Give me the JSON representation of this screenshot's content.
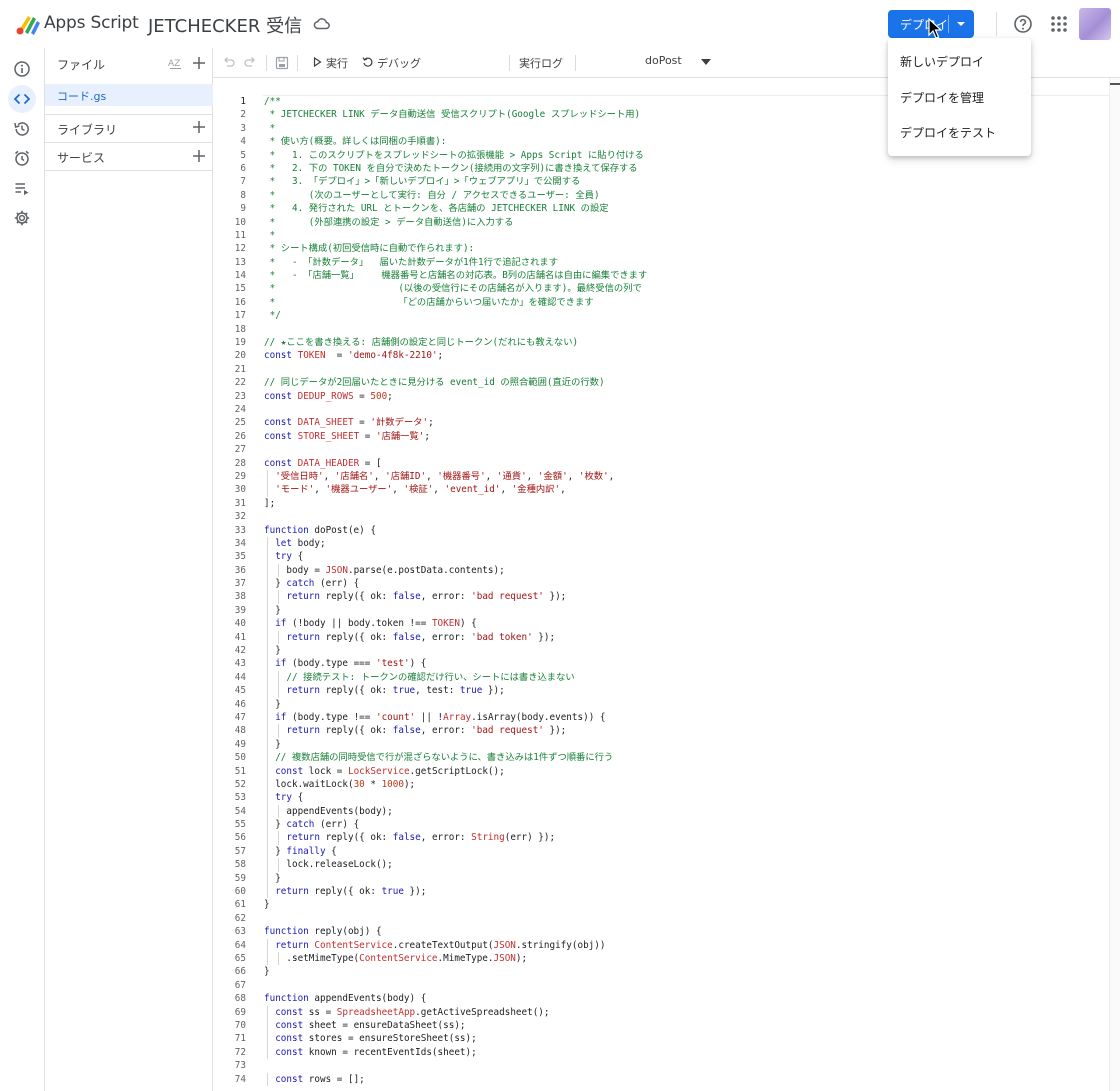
{
  "app": {
    "name": "Apps Script",
    "project_title": "JETCHECKER 受信"
  },
  "header": {
    "deploy_label": "デプロイ"
  },
  "deploy_menu": {
    "items": [
      "新しいデプロイ",
      "デプロイを管理",
      "デプロイをテスト"
    ]
  },
  "files_panel": {
    "title": "ファイル",
    "file": "コード.gs",
    "libraries": "ライブラリ",
    "services": "サービス"
  },
  "toolbar": {
    "run": "実行",
    "debug": "デバッグ",
    "function": "doPost",
    "log": "実行ログ"
  },
  "editor": {
    "active_line": 1,
    "lines": [
      [
        [
          "cm",
          "/**"
        ]
      ],
      [
        [
          "cm",
          " * JETCHECKER LINK データ自動送信 受信スクリプト(Google スプレッドシート用)"
        ]
      ],
      [
        [
          "cm",
          " *"
        ]
      ],
      [
        [
          "cm",
          " * 使い方(概要。詳しくは同梱の手順書):"
        ]
      ],
      [
        [
          "cm",
          " *   1. このスクリプトをスプレッドシートの拡張機能 > Apps Script に貼り付ける"
        ]
      ],
      [
        [
          "cm",
          " *   2. 下の TOKEN を自分で決めたトークン(接続用の文字列)に書き換えて保存する"
        ]
      ],
      [
        [
          "cm",
          " *   3. 「デプロイ」>「新しいデプロイ」>「ウェブアプリ」で公開する"
        ]
      ],
      [
        [
          "cm",
          " *      (次のユーザーとして実行: 自分 / アクセスできるユーザー: 全員)"
        ]
      ],
      [
        [
          "cm",
          " *   4. 発行された URL とトークンを、各店舗の JETCHECKER LINK の設定"
        ]
      ],
      [
        [
          "cm",
          " *      (外部連携の設定 > データ自動送信)に入力する"
        ]
      ],
      [
        [
          "cm",
          " *"
        ]
      ],
      [
        [
          "cm",
          " * シート構成(初回受信時に自動で作られます):"
        ]
      ],
      [
        [
          "cm",
          " *   - 「計数データ」  届いた計数データが1件1行で追記されます"
        ]
      ],
      [
        [
          "cm",
          " *   - 「店舗一覧」    機器番号と店舗名の対応表。B列の店舗名は自由に編集できます"
        ]
      ],
      [
        [
          "cm",
          " *                      (以後の受信行にその店舗名が入ります)。最終受信の列で"
        ]
      ],
      [
        [
          "cm",
          " *                      「どの店舗からいつ届いたか」を確認できます"
        ]
      ],
      [
        [
          "cm",
          " */"
        ]
      ],
      [],
      [
        [
          "cm",
          "// ★ここを書き換える: 店舗側の設定と同じトークン(だれにも教えない)"
        ]
      ],
      [
        [
          "kw",
          "const "
        ],
        [
          "va",
          "TOKEN"
        ],
        [
          "",
          "  = "
        ],
        [
          "st",
          "'demo-4f8k-2210'"
        ],
        [
          "",
          ";"
        ]
      ],
      [],
      [
        [
          "cm",
          "// 同じデータが2回届いたときに見分ける event_id の照合範囲(直近の行数)"
        ]
      ],
      [
        [
          "kw",
          "const "
        ],
        [
          "va",
          "DEDUP_ROWS"
        ],
        [
          "",
          " = "
        ],
        [
          "nu",
          "500"
        ],
        [
          "",
          ";"
        ]
      ],
      [],
      [
        [
          "kw",
          "const "
        ],
        [
          "va",
          "DATA_SHEET"
        ],
        [
          "",
          " = "
        ],
        [
          "st",
          "'計数データ'"
        ],
        [
          "",
          ";"
        ]
      ],
      [
        [
          "kw",
          "const "
        ],
        [
          "va",
          "STORE_SHEET"
        ],
        [
          "",
          " = "
        ],
        [
          "st",
          "'店舗一覧'"
        ],
        [
          "",
          ";"
        ]
      ],
      [],
      [
        [
          "kw",
          "const "
        ],
        [
          "va",
          "DATA_HEADER"
        ],
        [
          "",
          " = ["
        ]
      ],
      [
        [
          "",
          "  "
        ],
        [
          "st",
          "'受信日時'"
        ],
        [
          "",
          ", "
        ],
        [
          "st",
          "'店舗名'"
        ],
        [
          "",
          ", "
        ],
        [
          "st",
          "'店舗ID'"
        ],
        [
          "",
          ", "
        ],
        [
          "st",
          "'機器番号'"
        ],
        [
          "",
          ", "
        ],
        [
          "st",
          "'通貨'"
        ],
        [
          "",
          ", "
        ],
        [
          "st",
          "'金額'"
        ],
        [
          "",
          ", "
        ],
        [
          "st",
          "'枚数'"
        ],
        [
          "",
          ","
        ]
      ],
      [
        [
          "",
          "  "
        ],
        [
          "st",
          "'モード'"
        ],
        [
          "",
          ", "
        ],
        [
          "st",
          "'機器ユーザー'"
        ],
        [
          "",
          ", "
        ],
        [
          "st",
          "'検証'"
        ],
        [
          "",
          ", "
        ],
        [
          "st",
          "'event_id'"
        ],
        [
          "",
          ", "
        ],
        [
          "st",
          "'金種内訳'"
        ],
        [
          "",
          ","
        ]
      ],
      [
        [
          "",
          "];"
        ]
      ],
      [],
      [
        [
          "kw",
          "function "
        ],
        [
          "",
          "doPost(e) {"
        ]
      ],
      [
        [
          "",
          "  "
        ],
        [
          "kw",
          "let "
        ],
        [
          "",
          "body;"
        ]
      ],
      [
        [
          "",
          "  "
        ],
        [
          "kw",
          "try "
        ],
        [
          "",
          "{"
        ]
      ],
      [
        [
          "",
          "    body = "
        ],
        [
          "bi",
          "JSON"
        ],
        [
          "",
          ".parse(e.postData.contents);"
        ]
      ],
      [
        [
          "",
          "  } "
        ],
        [
          "kw",
          "catch "
        ],
        [
          "",
          "(err) {"
        ]
      ],
      [
        [
          "",
          "    "
        ],
        [
          "kw",
          "return "
        ],
        [
          "",
          "reply({ ok: "
        ],
        [
          "kw",
          "false"
        ],
        [
          "",
          ", error: "
        ],
        [
          "st",
          "'bad request'"
        ],
        [
          "",
          " });"
        ]
      ],
      [
        [
          "",
          "  }"
        ]
      ],
      [
        [
          "",
          "  "
        ],
        [
          "kw",
          "if "
        ],
        [
          "",
          "(!body || body.token !== "
        ],
        [
          "va",
          "TOKEN"
        ],
        [
          "",
          ") {"
        ]
      ],
      [
        [
          "",
          "    "
        ],
        [
          "kw",
          "return "
        ],
        [
          "",
          "reply({ ok: "
        ],
        [
          "kw",
          "false"
        ],
        [
          "",
          ", error: "
        ],
        [
          "st",
          "'bad token'"
        ],
        [
          "",
          " });"
        ]
      ],
      [
        [
          "",
          "  }"
        ]
      ],
      [
        [
          "",
          "  "
        ],
        [
          "kw",
          "if "
        ],
        [
          "",
          "(body.type === "
        ],
        [
          "st",
          "'test'"
        ],
        [
          "",
          ") {"
        ]
      ],
      [
        [
          "",
          "    "
        ],
        [
          "cm",
          "// 接続テスト: トークンの確認だけ行い、シートには書き込まない"
        ]
      ],
      [
        [
          "",
          "    "
        ],
        [
          "kw",
          "return "
        ],
        [
          "",
          "reply({ ok: "
        ],
        [
          "kw",
          "true"
        ],
        [
          "",
          ", test: "
        ],
        [
          "kw",
          "true"
        ],
        [
          "",
          " });"
        ]
      ],
      [
        [
          "",
          "  }"
        ]
      ],
      [
        [
          "",
          "  "
        ],
        [
          "kw",
          "if "
        ],
        [
          "",
          "(body.type !== "
        ],
        [
          "st",
          "'count'"
        ],
        [
          "",
          " || !"
        ],
        [
          "bi",
          "Array"
        ],
        [
          "",
          ".isArray(body.events)) {"
        ]
      ],
      [
        [
          "",
          "    "
        ],
        [
          "kw",
          "return "
        ],
        [
          "",
          "reply({ ok: "
        ],
        [
          "kw",
          "false"
        ],
        [
          "",
          ", error: "
        ],
        [
          "st",
          "'bad request'"
        ],
        [
          "",
          " });"
        ]
      ],
      [
        [
          "",
          "  }"
        ]
      ],
      [
        [
          "",
          "  "
        ],
        [
          "cm",
          "// 複数店舗の同時受信で行が混ざらないように、書き込みは1件ずつ順番に行う"
        ]
      ],
      [
        [
          "",
          "  "
        ],
        [
          "kw",
          "const "
        ],
        [
          "",
          "lock = "
        ],
        [
          "bi",
          "LockService"
        ],
        [
          "",
          ".getScriptLock();"
        ]
      ],
      [
        [
          "",
          "  lock.waitLock("
        ],
        [
          "nu",
          "30"
        ],
        [
          "",
          " * "
        ],
        [
          "nu",
          "1000"
        ],
        [
          "",
          ");"
        ]
      ],
      [
        [
          "",
          "  "
        ],
        [
          "kw",
          "try "
        ],
        [
          "",
          "{"
        ]
      ],
      [
        [
          "",
          "    appendEvents(body);"
        ]
      ],
      [
        [
          "",
          "  } "
        ],
        [
          "kw",
          "catch "
        ],
        [
          "",
          "(err) {"
        ]
      ],
      [
        [
          "",
          "    "
        ],
        [
          "kw",
          "return "
        ],
        [
          "",
          "reply({ ok: "
        ],
        [
          "kw",
          "false"
        ],
        [
          "",
          ", error: "
        ],
        [
          "bi",
          "String"
        ],
        [
          "",
          "(err) });"
        ]
      ],
      [
        [
          "",
          "  } "
        ],
        [
          "kw",
          "finally "
        ],
        [
          "",
          "{"
        ]
      ],
      [
        [
          "",
          "    lock.releaseLock();"
        ]
      ],
      [
        [
          "",
          "  }"
        ]
      ],
      [
        [
          "",
          "  "
        ],
        [
          "kw",
          "return "
        ],
        [
          "",
          "reply({ ok: "
        ],
        [
          "kw",
          "true"
        ],
        [
          "",
          " });"
        ]
      ],
      [
        [
          "",
          "}"
        ]
      ],
      [],
      [
        [
          "kw",
          "function "
        ],
        [
          "",
          "reply(obj) {"
        ]
      ],
      [
        [
          "",
          "  "
        ],
        [
          "kw",
          "return "
        ],
        [
          "bi",
          "ContentService"
        ],
        [
          "",
          ".createTextOutput("
        ],
        [
          "bi",
          "JSON"
        ],
        [
          "",
          ".stringify(obj))"
        ]
      ],
      [
        [
          "",
          "    .setMimeType("
        ],
        [
          "bi",
          "ContentService"
        ],
        [
          "",
          ".MimeType."
        ],
        [
          "bi",
          "JSON"
        ],
        [
          "",
          ");"
        ]
      ],
      [
        [
          "",
          "}"
        ]
      ],
      [],
      [
        [
          "kw",
          "function "
        ],
        [
          "",
          "appendEvents(body) {"
        ]
      ],
      [
        [
          "",
          "  "
        ],
        [
          "kw",
          "const "
        ],
        [
          "",
          "ss = "
        ],
        [
          "bi",
          "SpreadsheetApp"
        ],
        [
          "",
          ".getActiveSpreadsheet();"
        ]
      ],
      [
        [
          "",
          "  "
        ],
        [
          "kw",
          "const "
        ],
        [
          "",
          "sheet = ensureDataSheet(ss);"
        ]
      ],
      [
        [
          "",
          "  "
        ],
        [
          "kw",
          "const "
        ],
        [
          "",
          "stores = ensureStoreSheet(ss);"
        ]
      ],
      [
        [
          "",
          "  "
        ],
        [
          "kw",
          "const "
        ],
        [
          "",
          "known = recentEventIds(sheet);"
        ]
      ],
      [],
      [
        [
          "",
          "  "
        ],
        [
          "kw",
          "const "
        ],
        [
          "",
          "rows = [];"
        ]
      ]
    ]
  }
}
